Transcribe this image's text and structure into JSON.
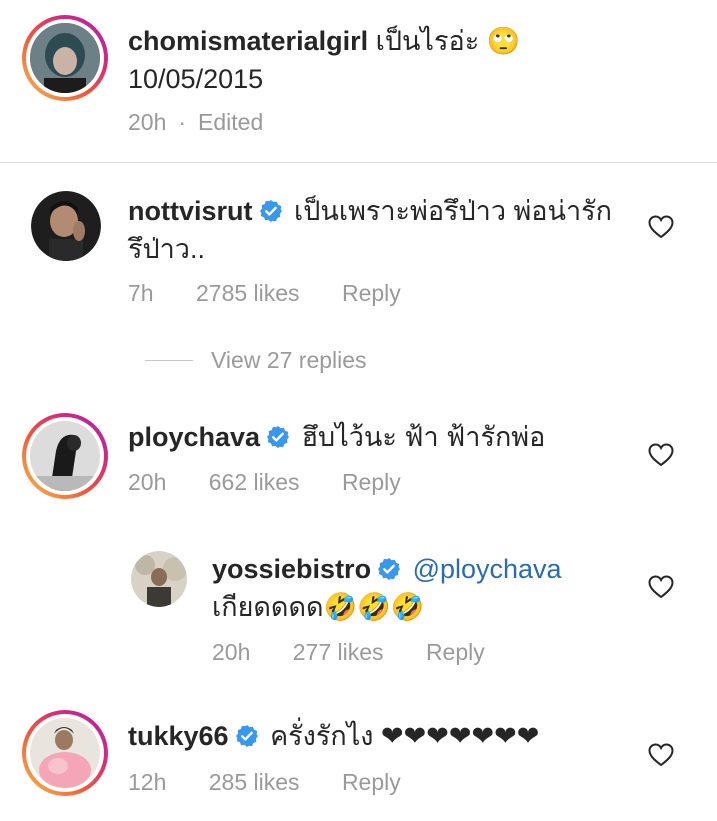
{
  "comments": [
    {
      "username": "chomismaterialgirl",
      "text": "เป็นไรอ่ะ 🙄",
      "line2": "10/05/2015",
      "time": "20h",
      "edited": "Edited"
    },
    {
      "username": "nottvisrut",
      "text": "เป็นเพราะพ่อรึป่าว พ่อน่ารัก",
      "line2": "รึป่าว..",
      "time": "7h",
      "likes": "2785 likes",
      "reply": "Reply"
    },
    {
      "username": "ploychava",
      "text": "ฮึบไว้นะ ฟ้า ฟ้ารักพ่อ",
      "time": "20h",
      "likes": "662 likes",
      "reply": "Reply"
    },
    {
      "username": "yossiebistro",
      "mention": "@ploychava",
      "line2": "เกียดดดด🤣🤣🤣",
      "time": "20h",
      "likes": "277 likes",
      "reply": "Reply"
    },
    {
      "username": "tukky66",
      "text": "ครั่งรักไง ❤❤❤❤❤❤❤",
      "time": "12h",
      "likes": "285 likes",
      "reply": "Reply"
    }
  ],
  "view_replies": "View 27 replies",
  "colors": {
    "verified": "#3897f0",
    "meta": "#9a9a9a",
    "mention": "#2b6cb0"
  }
}
